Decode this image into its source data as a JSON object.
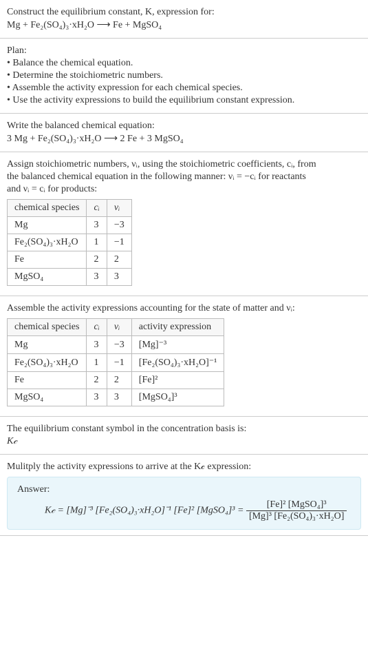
{
  "s1": {
    "title": "Construct the equilibrium constant, K, expression for:",
    "eq": "Mg + Fe₂(SO₄)₃·xH₂O  ⟶  Fe + MgSO₄"
  },
  "s2": {
    "title": "Plan:",
    "b1": "• Balance the chemical equation.",
    "b2": "• Determine the stoichiometric numbers.",
    "b3": "• Assemble the activity expression for each chemical species.",
    "b4": "• Use the activity expressions to build the equilibrium constant expression."
  },
  "s3": {
    "title": "Write the balanced chemical equation:",
    "eq": "3 Mg + Fe₂(SO₄)₃·xH₂O  ⟶  2 Fe + 3 MgSO₄"
  },
  "s4": {
    "intro1": "Assign stoichiometric numbers, νᵢ, using the stoichiometric coefficients, cᵢ, from",
    "intro2": "the balanced chemical equation in the following manner: νᵢ = −cᵢ for reactants",
    "intro3": "and νᵢ = cᵢ for products:",
    "h": {
      "a": "chemical species",
      "b": "cᵢ",
      "c": "νᵢ"
    },
    "r1": {
      "a": "Mg",
      "b": "3",
      "c": "−3"
    },
    "r2": {
      "a": "Fe₂(SO₄)₃·xH₂O",
      "b": "1",
      "c": "−1"
    },
    "r3": {
      "a": "Fe",
      "b": "2",
      "c": "2"
    },
    "r4": {
      "a": "MgSO₄",
      "b": "3",
      "c": "3"
    }
  },
  "s5": {
    "intro": "Assemble the activity expressions accounting for the state of matter and νᵢ:",
    "h": {
      "a": "chemical species",
      "b": "cᵢ",
      "c": "νᵢ",
      "d": "activity expression"
    },
    "r1": {
      "a": "Mg",
      "b": "3",
      "c": "−3",
      "d": "[Mg]⁻³"
    },
    "r2": {
      "a": "Fe₂(SO₄)₃·xH₂O",
      "b": "1",
      "c": "−1",
      "d": "[Fe₂(SO₄)₃·xH₂O]⁻¹"
    },
    "r3": {
      "a": "Fe",
      "b": "2",
      "c": "2",
      "d": "[Fe]²"
    },
    "r4": {
      "a": "MgSO₄",
      "b": "3",
      "c": "3",
      "d": "[MgSO₄]³"
    }
  },
  "s6": {
    "l1": "The equilibrium constant symbol in the concentration basis is:",
    "l2": "K𝒸"
  },
  "s7": {
    "intro": "Mulitply the activity expressions to arrive at the K𝒸 expression:",
    "answer_label": "Answer:",
    "lhs": "K𝒸 = [Mg]⁻³ [Fe₂(SO₄)₃·xH₂O]⁻¹ [Fe]² [MgSO₄]³ = ",
    "num": "[Fe]² [MgSO₄]³",
    "den": "[Mg]³ [Fe₂(SO₄)₃·xH₂O]"
  }
}
